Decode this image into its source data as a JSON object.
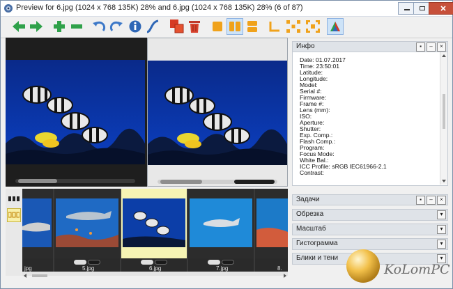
{
  "window": {
    "title": "Preview for 6.jpg (1024 x 768 135K) 28% and 6.jpg (1024 x 768 135K) 28% (6 of 87)"
  },
  "toolbar": {
    "icons": [
      "arrow-left-icon",
      "arrow-right-icon",
      "plus-icon",
      "minus-icon",
      "rotate-left-icon",
      "rotate-right-icon",
      "info-icon",
      "curve-icon",
      "copy-icon",
      "trash-icon",
      "single-view-icon",
      "split-vertical-icon",
      "split-horizontal-icon",
      "corner-icon",
      "fit-icon",
      "fullscreen-icon",
      "color-icon"
    ]
  },
  "info_panel": {
    "header": "Инфо",
    "lines": [
      "Date: 01.07.2017",
      "Time: 23:50:01",
      "Latitude:",
      "Longitude:",
      "Model:",
      "Serial #:",
      "Firmware:",
      "Frame #:",
      "Lens (mm):",
      "ISO:",
      "Aperture:",
      "Shutter:",
      "Exp. Comp.:",
      "Flash Comp.:",
      "Program:",
      "Focus Mode:",
      "White Bal.:",
      "ICC Profile: sRGB IEC61966-2.1",
      "Contrast:"
    ]
  },
  "panels": [
    {
      "label": "Задачи"
    },
    {
      "label": "Обрезка"
    },
    {
      "label": "Масштаб"
    },
    {
      "label": "Гистограмма"
    },
    {
      "label": "Блики и тени"
    }
  ],
  "thumbnails": [
    {
      "filename": "jpg"
    },
    {
      "filename": "5.jpg"
    },
    {
      "filename": "6.jpg"
    },
    {
      "filename": "7.jpg"
    },
    {
      "filename": "8."
    }
  ],
  "watermark": {
    "text": "KoLomPC"
  },
  "colors": {
    "accent": "#3c78c8",
    "selected_thumb": "#f6f4b4"
  }
}
